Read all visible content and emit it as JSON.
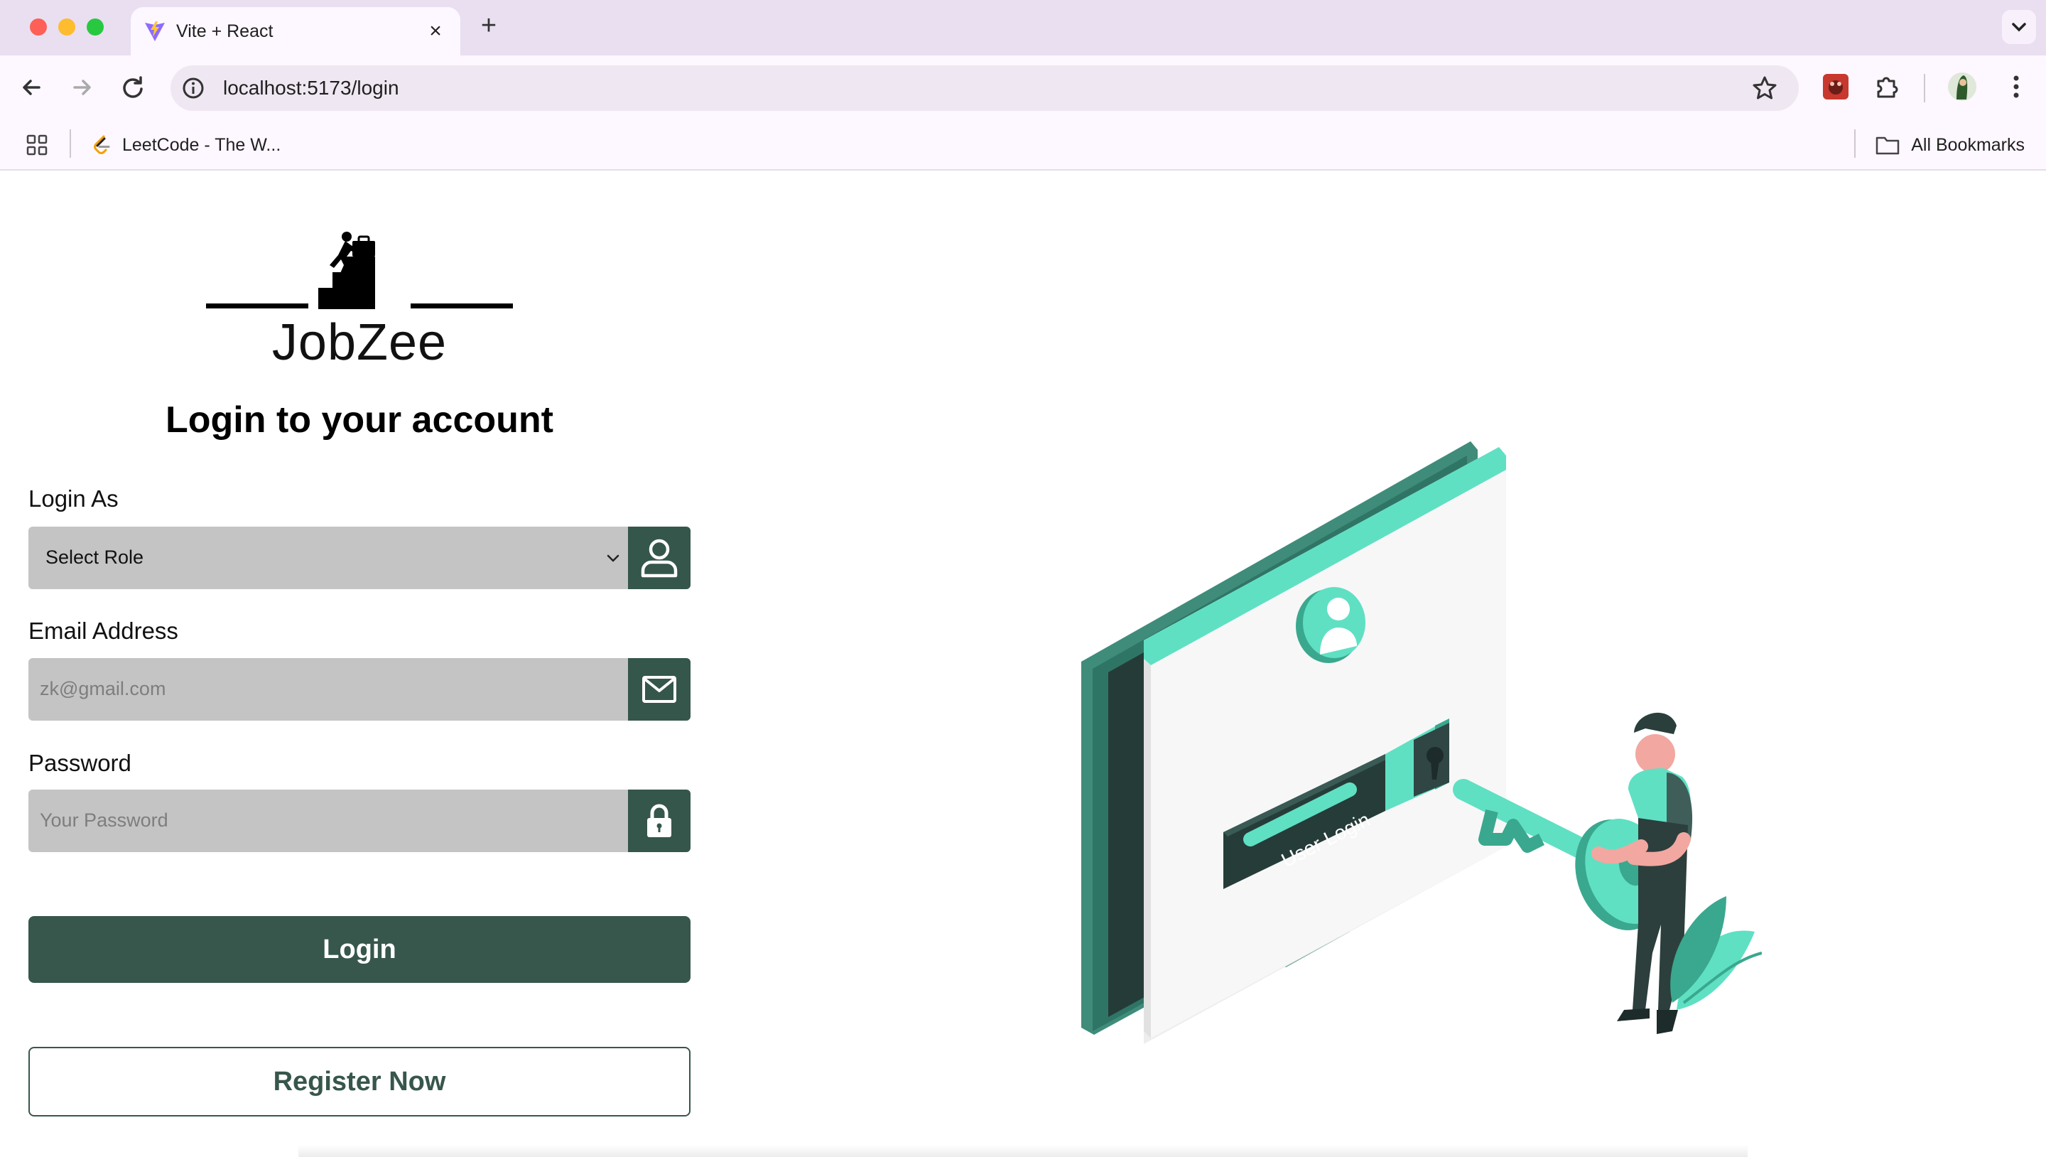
{
  "browser": {
    "tab_title": "Vite + React",
    "url": "localhost:5173/login",
    "bookmark_item": "LeetCode - The W...",
    "all_bookmarks": "All Bookmarks"
  },
  "brand": {
    "name": "JobZee"
  },
  "login": {
    "heading": "Login to your account",
    "role_label": "Login As",
    "role_selected": "Select Role",
    "email_label": "Email Address",
    "email_placeholder": "zk@gmail.com",
    "password_label": "Password",
    "password_placeholder": "Your Password",
    "login_button": "Login",
    "register_button": "Register Now"
  },
  "illustration": {
    "screen_text": "User Login"
  },
  "colors": {
    "primary": "#37564c",
    "field_bg": "#c4c4c4",
    "accent": "#5ee0c0"
  }
}
